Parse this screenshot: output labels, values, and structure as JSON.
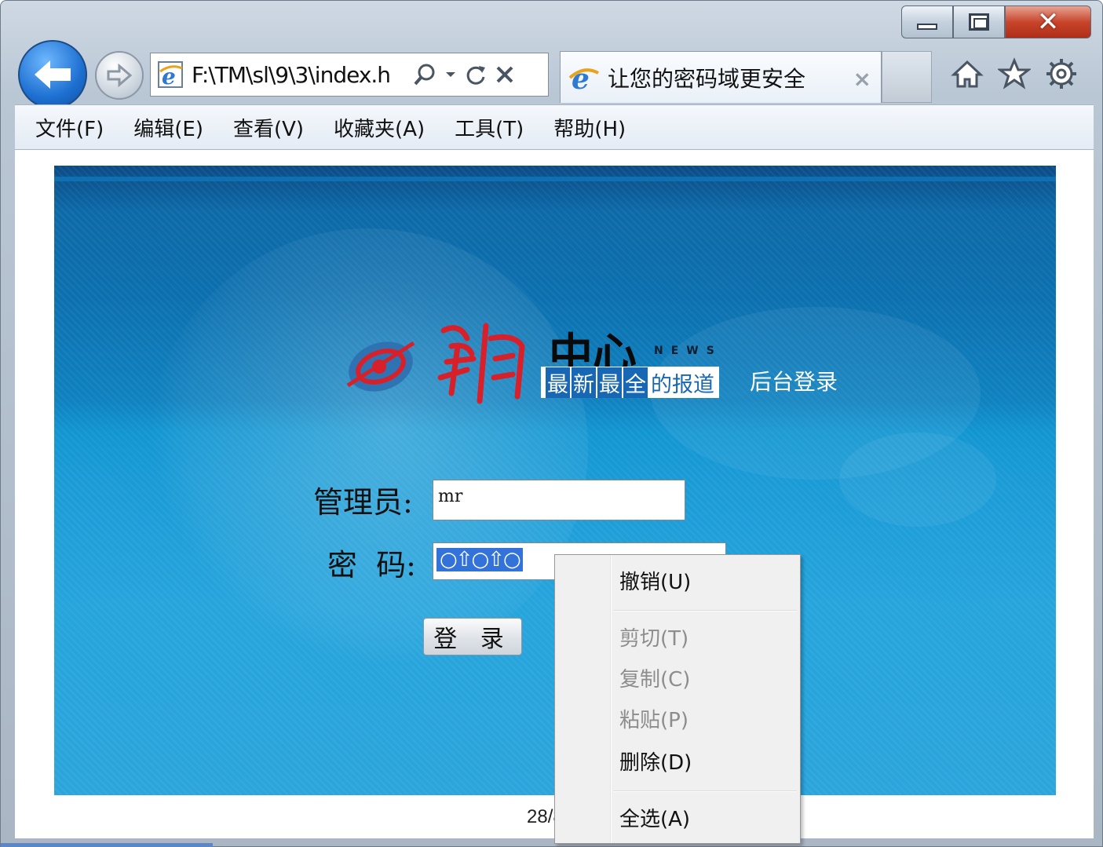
{
  "window": {
    "buttons": {
      "minimize": "minimize-icon",
      "maximize": "maximize-icon",
      "close": "close-icon"
    }
  },
  "address_bar": {
    "url": "F:\\TM\\sl\\9\\3\\index.h",
    "icons": [
      "search-icon",
      "dropdown-icon",
      "refresh-icon",
      "stop-icon"
    ]
  },
  "tab": {
    "title": "让您的密码域更安全",
    "close": "×"
  },
  "toolbar_icons": [
    "home-icon",
    "favorites-icon",
    "settings-icon"
  ],
  "menu": {
    "items": [
      "文件(F)",
      "编辑(E)",
      "查看(V)",
      "收藏夹(A)",
      "工具(T)",
      "帮助(H)"
    ]
  },
  "brand": {
    "title": "中心",
    "news": "NEWS",
    "chip_highlight": [
      "最",
      "新",
      "最",
      "全"
    ],
    "chip_rest": "的报道",
    "subtitle": "后台登录",
    "accent": "#1867b5",
    "logo_color": "#d8202a"
  },
  "form": {
    "admin_label": "管理员:",
    "admin_value": "mr",
    "password_label": "密  码:",
    "password_value": "○⇧○⇧○",
    "login_button": "登 录"
  },
  "context_menu": {
    "items": [
      {
        "label": "撤销(U)",
        "enabled": true
      },
      {
        "label": "剪切(T)",
        "enabled": false
      },
      {
        "label": "复制(C)",
        "enabled": false
      },
      {
        "label": "粘贴(P)",
        "enabled": false
      },
      {
        "label": "删除(D)",
        "enabled": true
      },
      {
        "label": "全选(A)",
        "enabled": true
      }
    ]
  },
  "footer": {
    "page_number": "28/88"
  }
}
